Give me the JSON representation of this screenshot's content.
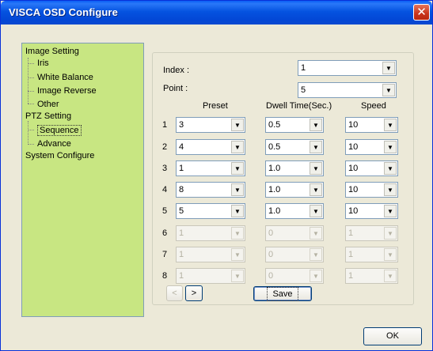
{
  "window": {
    "title": "VISCA OSD Configure",
    "close_label": "✕"
  },
  "tree": {
    "image_setting": "Image Setting",
    "iris": "Iris",
    "white_balance": "White Balance",
    "image_reverse": "Image Reverse",
    "other": "Other",
    "ptz_setting": "PTZ Setting",
    "sequence": "Sequence",
    "advance": "Advance",
    "system_configure": "System Configure"
  },
  "form": {
    "index_label": "Index :",
    "index_value": "1",
    "point_label": "Point :",
    "point_value": "5",
    "col_preset": "Preset",
    "col_dwell": "Dwell Time(Sec.)",
    "col_speed": "Speed"
  },
  "rows": [
    {
      "num": "1",
      "preset": "3",
      "dwell": "0.5",
      "speed": "10"
    },
    {
      "num": "2",
      "preset": "4",
      "dwell": "0.5",
      "speed": "10"
    },
    {
      "num": "3",
      "preset": "1",
      "dwell": "1.0",
      "speed": "10"
    },
    {
      "num": "4",
      "preset": "8",
      "dwell": "1.0",
      "speed": "10"
    },
    {
      "num": "5",
      "preset": "5",
      "dwell": "1.0",
      "speed": "10"
    },
    {
      "num": "6",
      "preset": "1",
      "dwell": "0",
      "speed": "1"
    },
    {
      "num": "7",
      "preset": "1",
      "dwell": "0",
      "speed": "1"
    },
    {
      "num": "8",
      "preset": "1",
      "dwell": "0",
      "speed": "1"
    }
  ],
  "buttons": {
    "prev": "<",
    "next": ">",
    "save": "Save",
    "ok": "OK"
  },
  "icons": {
    "dropdown": "▼"
  }
}
